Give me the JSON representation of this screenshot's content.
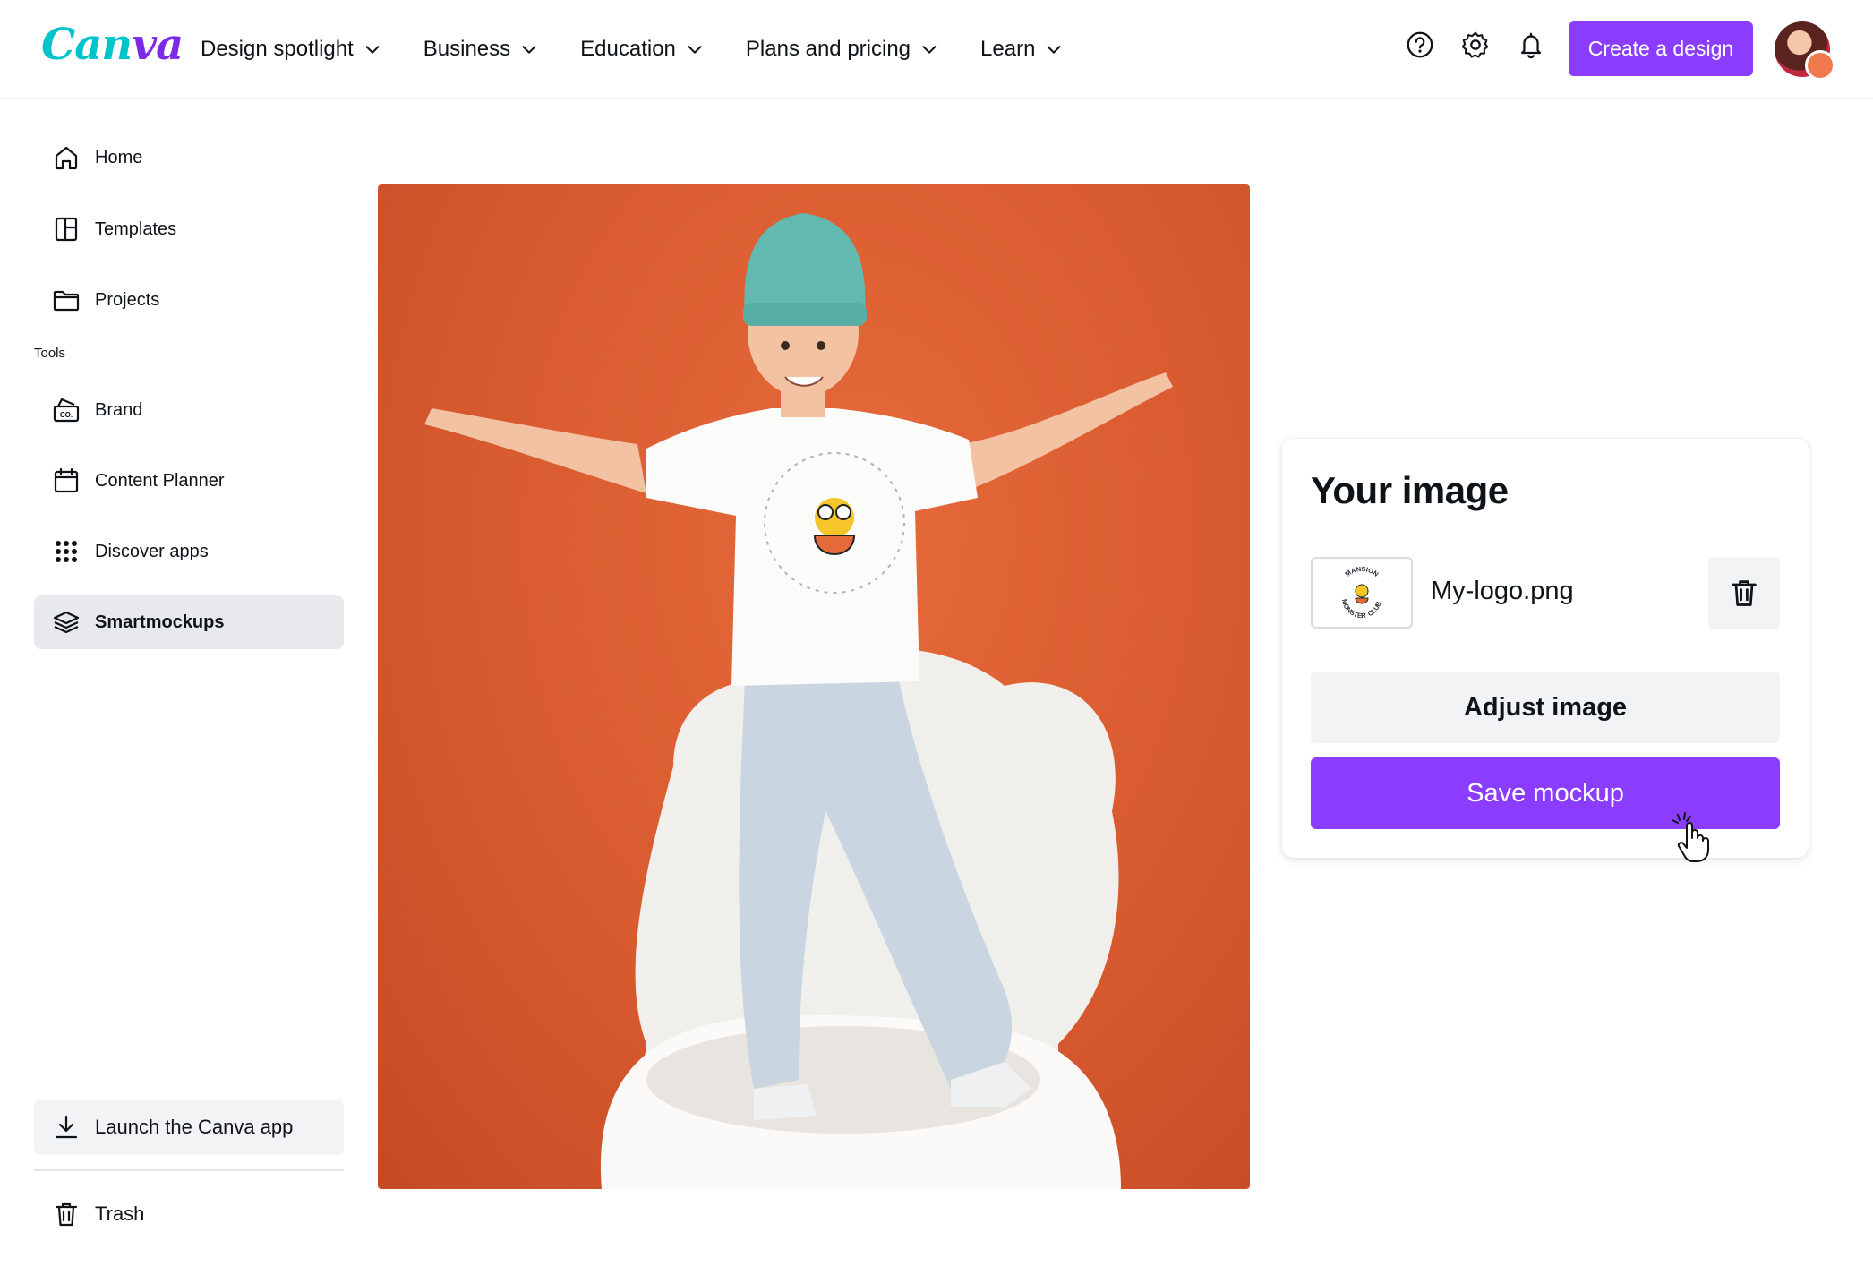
{
  "brand": {
    "logo_text_a": "Can",
    "logo_text_b": "va"
  },
  "nav": {
    "items": [
      {
        "label": "Design spotlight"
      },
      {
        "label": "Business"
      },
      {
        "label": "Education"
      },
      {
        "label": "Plans and pricing"
      },
      {
        "label": "Learn"
      }
    ],
    "create_label": "Create a design",
    "icons": [
      "help-icon",
      "settings-icon",
      "bell-icon"
    ]
  },
  "sidebar": {
    "items": [
      {
        "label": "Home",
        "icon": "home-icon"
      },
      {
        "label": "Templates",
        "icon": "templates-icon"
      },
      {
        "label": "Projects",
        "icon": "folder-icon"
      }
    ],
    "section_label": "Tools",
    "tools": [
      {
        "label": "Brand",
        "icon": "brand-kit-icon"
      },
      {
        "label": "Content Planner",
        "icon": "calendar-icon"
      },
      {
        "label": "Discover apps",
        "icon": "apps-grid-icon"
      },
      {
        "label": "Smartmockups",
        "icon": "layers-icon",
        "active": true
      }
    ],
    "launch_label": "Launch the Canva app",
    "trash_label": "Trash"
  },
  "panel": {
    "title": "Your image",
    "file_name": "My-logo.png",
    "adjust_label": "Adjust image",
    "save_label": "Save mockup",
    "logo_text_top": "MANSION",
    "logo_text_left": "MONSTER",
    "logo_text_right": "CLUB"
  },
  "colors": {
    "accent": "#8b3dff",
    "logo_teal": "#00c4cc",
    "photo_background": "#d85a2f"
  }
}
